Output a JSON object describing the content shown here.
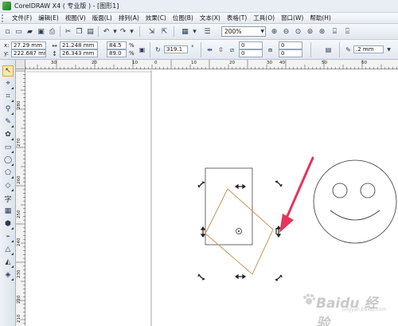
{
  "window": {
    "title": "CorelDRAW X4 ( 专业版 ) - [图形1]"
  },
  "menu": {
    "items": [
      "文件(F)",
      "编辑(E)",
      "视图(V)",
      "版面(L)",
      "排列(A)",
      "效果(C)",
      "位图(B)",
      "文本(X)",
      "表格(T)",
      "工具(O)",
      "窗口(W)",
      "帮助(H)"
    ]
  },
  "toolbar": {
    "zoom_value": "200%"
  },
  "property_bar": {
    "x_label": "x:",
    "x_value": "27.29 mm",
    "y_label": "y:",
    "y_value": "222.687 mm",
    "width_value": "21.248 mm",
    "height_value": "26.343 mm",
    "scale_x": "84.5",
    "scale_y": "89.0",
    "percent_1": "%",
    "percent_2": "%",
    "rotation_value": "319.1",
    "degree_symbol": "°",
    "skew_h": "0",
    "skew_v": "0",
    "skew_h2": "0",
    "skew_v2": "0",
    "outline_width": ".2 mm"
  },
  "rulers": {
    "horizontal_labels": [
      "30",
      "20",
      "10",
      "0",
      "10",
      "20",
      "30",
      "40",
      "50",
      "60"
    ],
    "vertical_labels": [
      "280",
      "270",
      "260",
      "250",
      "240",
      "230",
      "220",
      "210"
    ]
  },
  "watermark": {
    "brand": "Baidu 经验",
    "subtitle": "jingyan.baidu.com"
  },
  "colors": {
    "selection_rect": "#444444",
    "rotated_square": "#c8955a",
    "arrow": "#e8335c",
    "smiley": "#333333",
    "page_border": "#8c8c8c"
  }
}
